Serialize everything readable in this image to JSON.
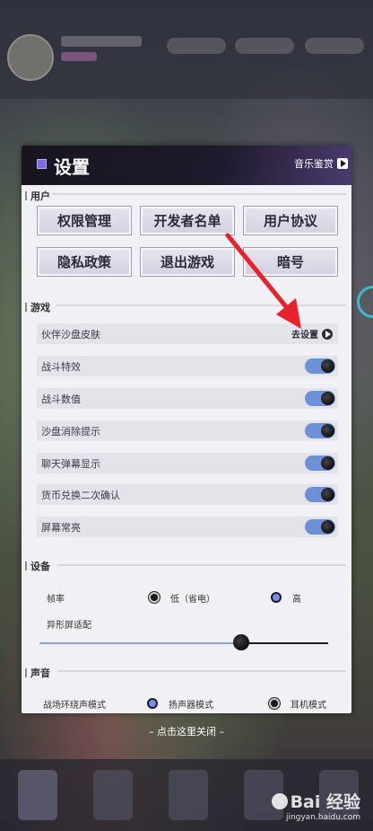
{
  "header": {
    "title": "设置",
    "music_label": "音乐鉴赏"
  },
  "sections": {
    "user": "用户",
    "game": "游戏",
    "device": "设备",
    "sound": "声音"
  },
  "user_buttons": [
    "权限管理",
    "开发者名单",
    "用户协议",
    "隐私政策",
    "退出游戏",
    "暗号"
  ],
  "game_rows": {
    "partner_skin": {
      "label": "伙伴沙盘皮肤",
      "action": "去设置"
    },
    "toggles": [
      {
        "label": "战斗特效",
        "on": true
      },
      {
        "label": "战斗数值",
        "on": true
      },
      {
        "label": "沙盘消除提示",
        "on": true
      },
      {
        "label": "聊天弹幕显示",
        "on": true
      },
      {
        "label": "货币兑换二次确认",
        "on": true
      },
      {
        "label": "屏幕常亮",
        "on": true
      }
    ]
  },
  "device": {
    "framerate_label": "帧率",
    "framerate_low": "低（省电）",
    "framerate_high": "高",
    "framerate_selected": "高",
    "notch_label": "异形屏适配",
    "notch_value": 0.7
  },
  "sound": {
    "ambient_label": "战场环绕声模式",
    "speaker": "扬声器模式",
    "headphone": "耳机模式",
    "selected": "扬声器模式"
  },
  "close_hint": "– 点击这里关闭 –",
  "watermark": {
    "brand": "Bai 经验",
    "url": "jingyan.baidu.com"
  },
  "colors": {
    "toggle_on": "#6d90d8",
    "radio_selected": "#7a8fe8",
    "annotation_arrow": "#e8222a"
  }
}
